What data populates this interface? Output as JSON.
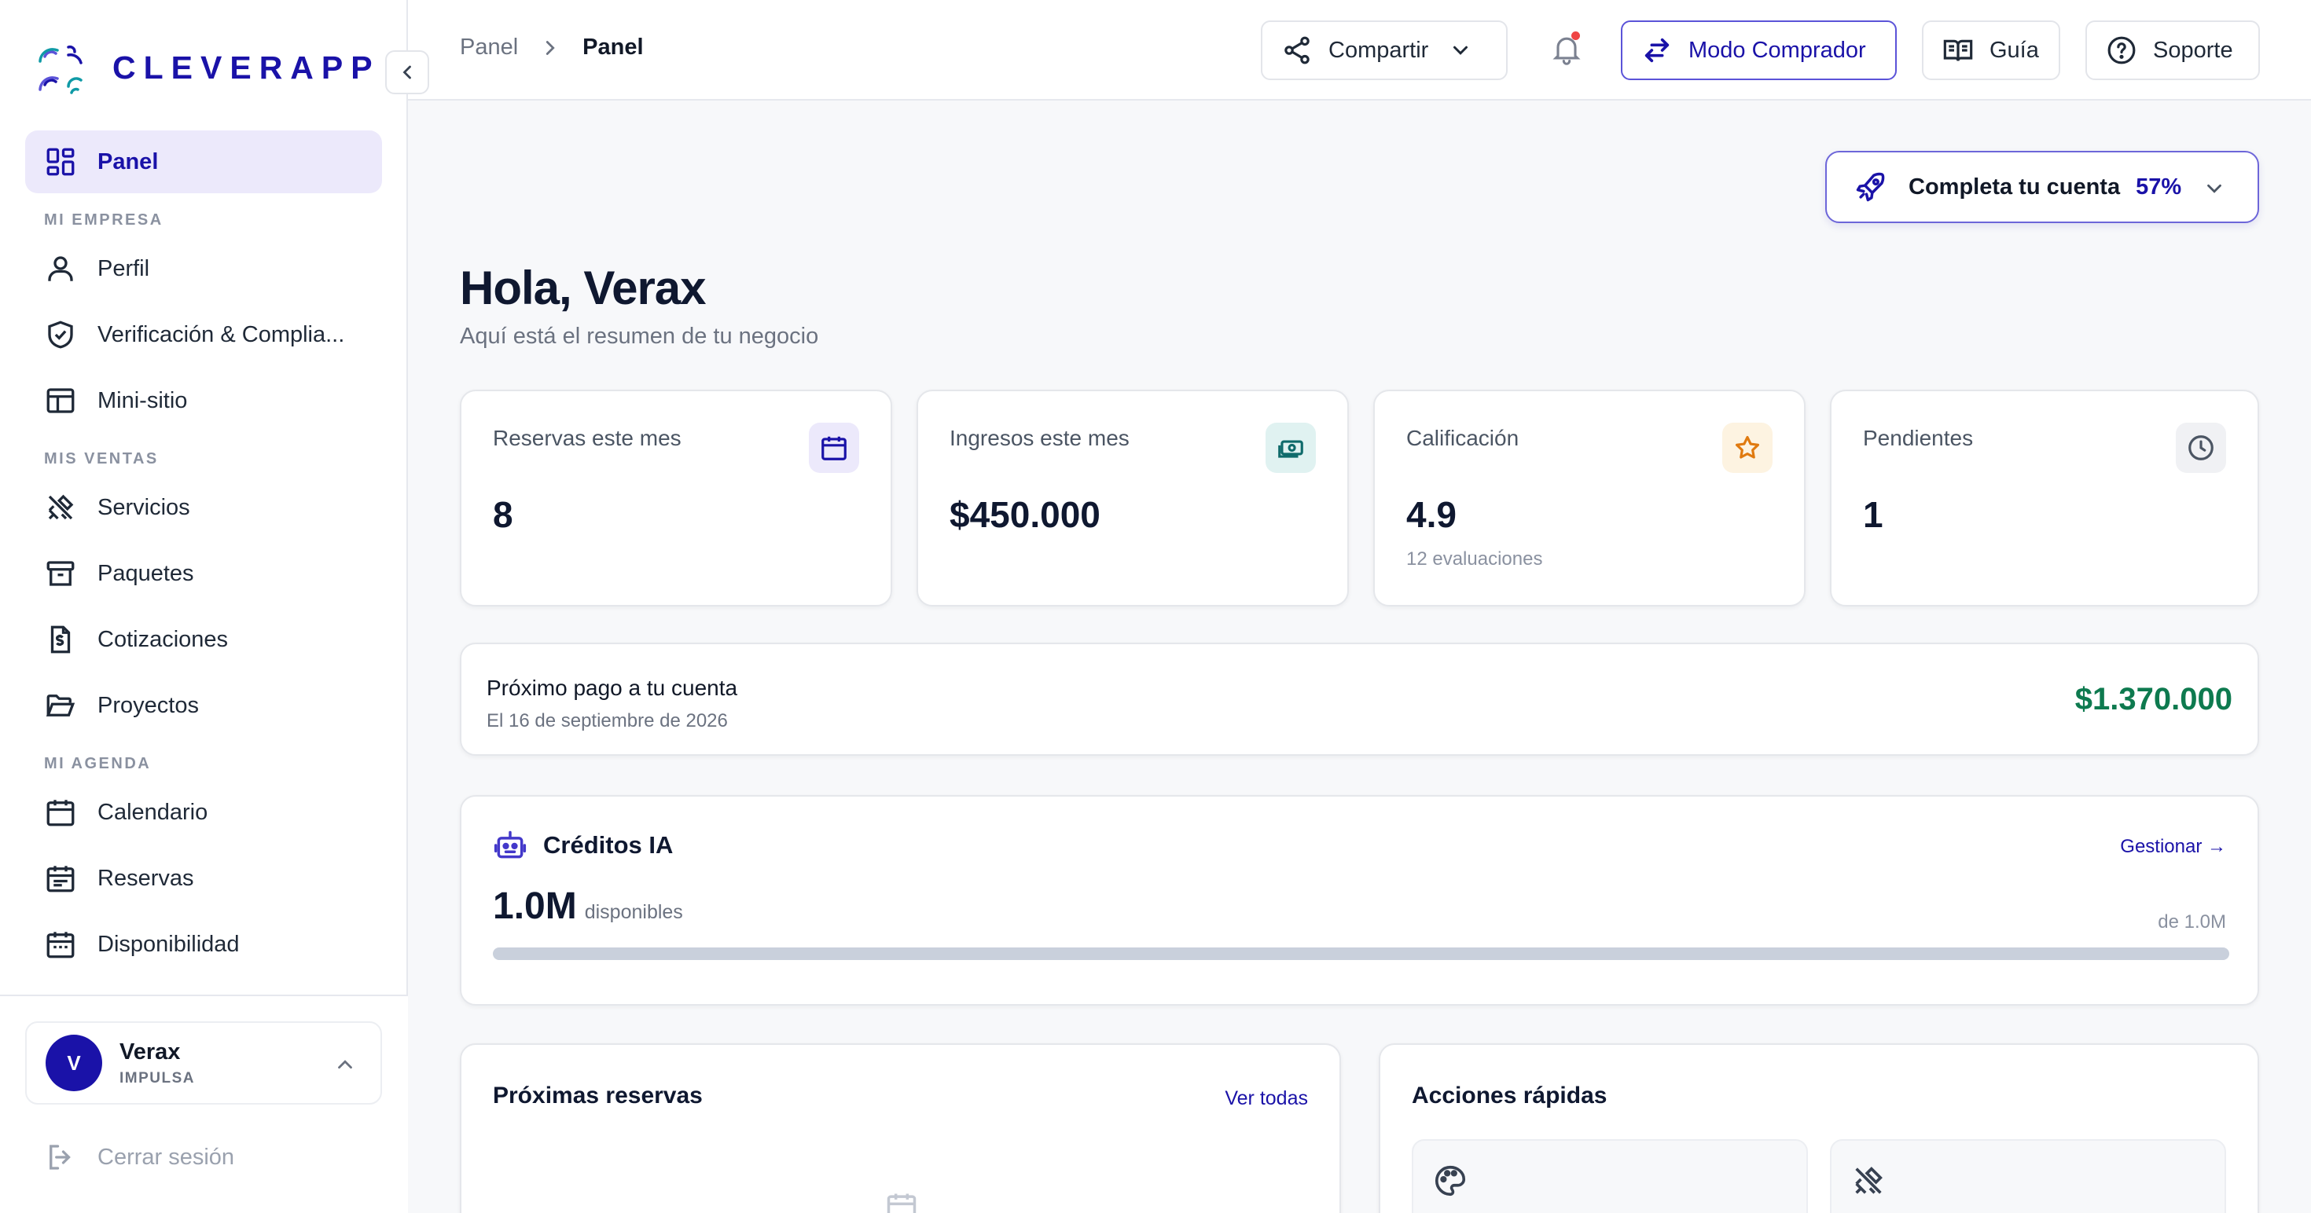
{
  "brand": {
    "name": "CLEVERAPP"
  },
  "sidebar": {
    "items": [
      {
        "label": "Panel",
        "icon": "dashboard-icon",
        "active": true
      },
      {
        "section": "MI EMPRESA"
      },
      {
        "label": "Perfil",
        "icon": "user-icon"
      },
      {
        "label": "Verificación & Complia...",
        "icon": "shield-check-icon"
      },
      {
        "label": "Mini-sitio",
        "icon": "browser-icon"
      },
      {
        "section": "MIS VENTAS"
      },
      {
        "label": "Servicios",
        "icon": "tools-icon"
      },
      {
        "label": "Paquetes",
        "icon": "archive-icon"
      },
      {
        "label": "Cotizaciones",
        "icon": "invoice-icon"
      },
      {
        "label": "Proyectos",
        "icon": "folder-open-icon"
      },
      {
        "section": "MI AGENDA"
      },
      {
        "label": "Calendario",
        "icon": "calendar-icon"
      },
      {
        "label": "Reservas",
        "icon": "calendar-list-icon"
      },
      {
        "label": "Disponibilidad",
        "icon": "calendar-clock-icon"
      }
    ],
    "user": {
      "initial": "V",
      "name": "Verax",
      "plan": "IMPULSA"
    },
    "logout_label": "Cerrar sesión"
  },
  "topbar": {
    "breadcrumb": [
      "Panel",
      "Panel"
    ],
    "share_label": "Compartir",
    "buyer_mode_label": "Modo Comprador",
    "guide_label": "Guía",
    "support_label": "Soporte"
  },
  "account_progress": {
    "label": "Completa tu cuenta",
    "percent_text": "57%",
    "percent": 57
  },
  "greeting": {
    "title": "Hola, Verax",
    "subtitle": "Aquí está el resumen de tu negocio"
  },
  "stats": [
    {
      "label": "Reservas este mes",
      "value": "8",
      "icon": "calendar-icon"
    },
    {
      "label": "Ingresos este mes",
      "value": "$450.000",
      "icon": "money-icon"
    },
    {
      "label": "Calificación",
      "value": "4.9",
      "sub": "12 evaluaciones",
      "icon": "star-icon"
    },
    {
      "label": "Pendientes",
      "value": "1",
      "icon": "clock-icon"
    }
  ],
  "payout": {
    "title": "Próximo pago a tu cuenta",
    "date": "El 16 de septiembre de 2026",
    "amount": "$1.370.000"
  },
  "ai_credits": {
    "title": "Créditos IA",
    "manage_label": "Gestionar →",
    "value": "1.0M",
    "unit": "disponibles",
    "max_label": "de 1.0M",
    "fill_fraction": 1.0
  },
  "upcoming": {
    "title": "Próximas reservas",
    "link": "Ver todas"
  },
  "quick_actions": {
    "title": "Acciones rápidas",
    "tiles": [
      {
        "icon": "palette-icon"
      },
      {
        "icon": "tools-icon"
      }
    ]
  },
  "colors": {
    "brand": "#1a12a8",
    "active_bg": "#ece9fb",
    "payout_green": "#0e7a4f"
  }
}
